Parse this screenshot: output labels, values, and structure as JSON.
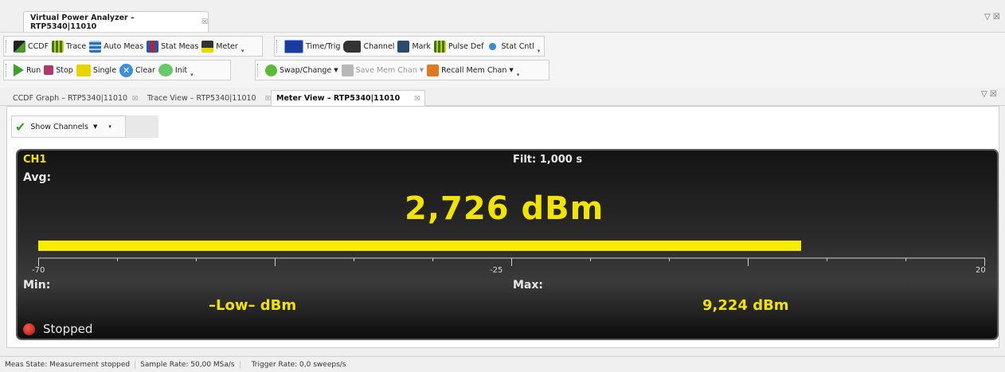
{
  "window": {
    "title": "Virtual Power Analyzer – RTP5340|11010",
    "close_glyph": "☒",
    "ctrl_glyph": "▽ ☒"
  },
  "toolbar1": {
    "items": [
      "CCDF",
      "Trace",
      "Auto Meas",
      "Stat Meas",
      "Meter"
    ]
  },
  "toolbar2": {
    "items": [
      "Time/Trig",
      "Channel",
      "Mark",
      "Pulse Def",
      "Stat Cntl"
    ]
  },
  "toolbar3": {
    "items": [
      "Run",
      "Stop",
      "Single",
      "Clear",
      "Init"
    ]
  },
  "toolbar4": {
    "items": [
      "Swap/Change",
      "Save Mem Chan",
      "Recall Mem Chan"
    ]
  },
  "view_tabs": [
    {
      "label": "CCDF Graph – RTP5340|11010"
    },
    {
      "label": "Trace View – RTP5340|11010"
    },
    {
      "label": "Meter View – RTP5340|11010"
    }
  ],
  "show_channels": {
    "label": "Show Channels"
  },
  "meter": {
    "channel": "CH1",
    "filter": "Filt: 1,000 s",
    "avg_label": "Avg:",
    "avg_value": "2,726 dBm",
    "bar_fraction": 0.808,
    "scale": {
      "min": "-70",
      "mid": "-25",
      "max": "20"
    },
    "min_label": "Min:",
    "min_value": "–Low– dBm",
    "max_label": "Max:",
    "max_value": "9,224 dBm",
    "state": "Stopped"
  },
  "status": {
    "meas_state": "Meas State: Measurement stopped",
    "sample_rate": "Sample Rate: 50,00 MSa/s",
    "trigger_rate": "Trigger Rate: 0,0 sweeps/s"
  },
  "colors": {
    "bar": "#f8ec00",
    "value_text": "#f2e400",
    "led": "#c8201a"
  }
}
